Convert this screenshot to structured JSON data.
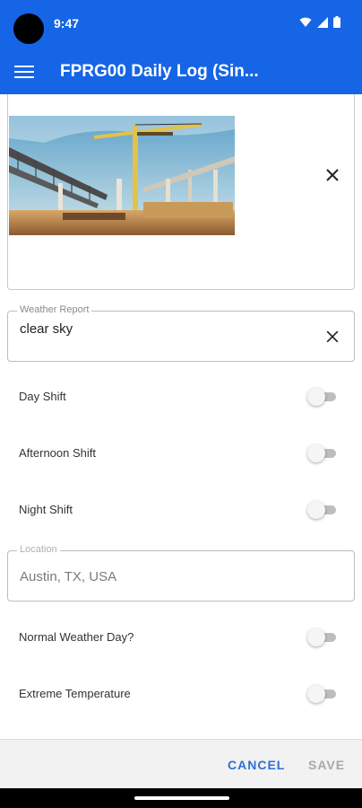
{
  "status_bar": {
    "time": "9:47"
  },
  "app_bar": {
    "title": "FPRG00 Daily Log (Sin..."
  },
  "photo": {
    "icon": "construction-site-photo"
  },
  "weather_report": {
    "label": "Weather Report",
    "value": "clear sky"
  },
  "shifts": [
    {
      "label": "Day Shift",
      "on": false
    },
    {
      "label": "Afternoon Shift",
      "on": false
    },
    {
      "label": "Night Shift",
      "on": false
    }
  ],
  "location": {
    "label": "Location",
    "value": "Austin, TX, USA"
  },
  "conditions": [
    {
      "label": "Normal Weather Day?",
      "on": false
    },
    {
      "label": "Extreme Temperature",
      "on": false
    }
  ],
  "actions": {
    "cancel": "CANCEL",
    "save": "SAVE"
  },
  "colors": {
    "primary": "#1565e6",
    "accent": "#2f6fd6",
    "disabled": "#a8a8a8"
  }
}
